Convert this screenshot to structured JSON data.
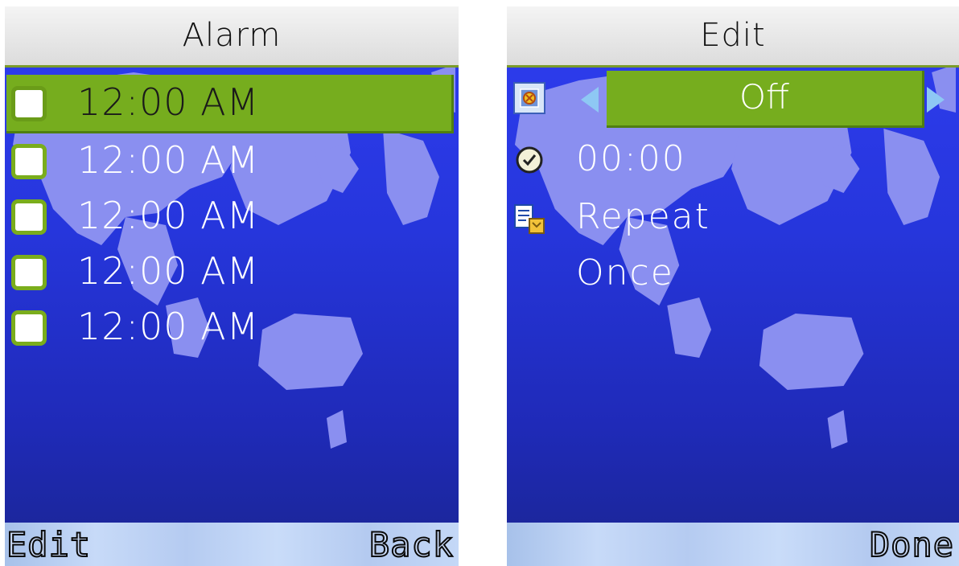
{
  "alarm_screen": {
    "title": "Alarm",
    "alarms": [
      {
        "time": "12:00 AM",
        "enabled": false,
        "selected": true
      },
      {
        "time": "12:00 AM",
        "enabled": false,
        "selected": false
      },
      {
        "time": "12:00 AM",
        "enabled": false,
        "selected": false
      },
      {
        "time": "12:00 AM",
        "enabled": false,
        "selected": false
      },
      {
        "time": "12:00 AM",
        "enabled": false,
        "selected": false
      }
    ],
    "softkeys": {
      "left": "Edit",
      "right": "Back"
    }
  },
  "edit_screen": {
    "title": "Edit",
    "state": "Off",
    "time": "00:00",
    "repeat_label": "Repeat",
    "repeat_value": "Once",
    "softkeys": {
      "left": "",
      "right": "Done"
    }
  },
  "colors": {
    "highlight": "#76ad1e",
    "background": "#2636dc",
    "softkey_bar": "#b5cbf1",
    "text": "#ffffff"
  },
  "icons": [
    "alarm-status-icon",
    "clock-icon",
    "repeat-icon",
    "left-arrow-icon",
    "right-arrow-icon",
    "world-map"
  ]
}
